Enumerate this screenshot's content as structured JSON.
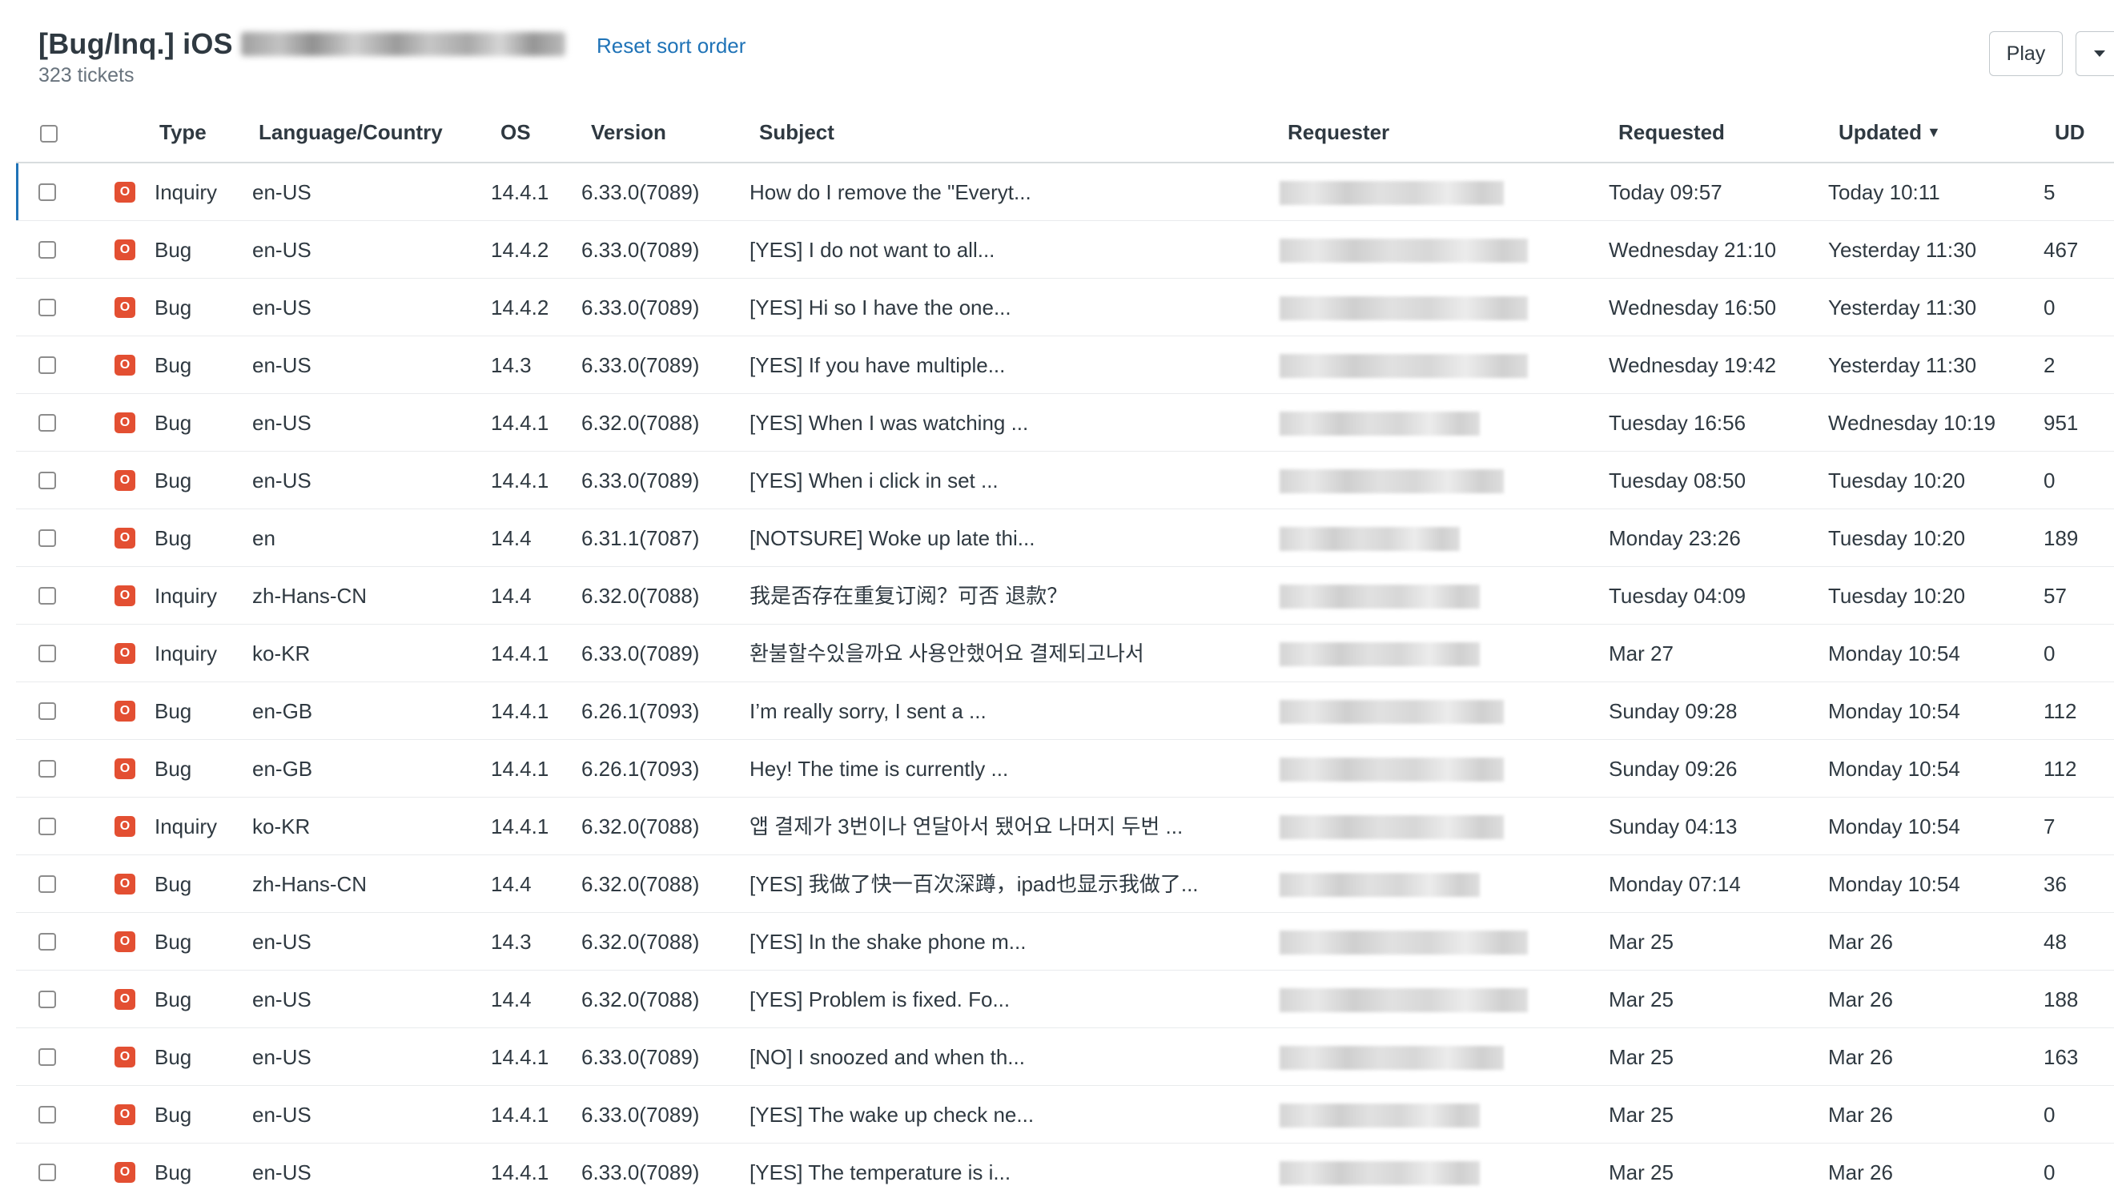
{
  "header": {
    "title": "[Bug/Inq.] iOS",
    "reset_link": "Reset sort order",
    "count": "323 tickets",
    "play_label": "Play"
  },
  "columns": {
    "type": "Type",
    "language": "Language/Country",
    "os": "OS",
    "version": "Version",
    "subject": "Subject",
    "requester": "Requester",
    "requested": "Requested",
    "updated": "Updated",
    "updated_sort": "▼",
    "ud": "UD"
  },
  "status_icon_letter": "O",
  "colors": {
    "accent": "#1f73b7",
    "open_status": "#e34f32"
  },
  "rows": [
    {
      "type": "Inquiry",
      "lang": "en-US",
      "os": "14.4.1",
      "version": "6.33.0(7089)",
      "subject": "How do I remove the \"Everyt...",
      "requested": "Today 09:57",
      "updated": "Today 10:11",
      "ud": "5"
    },
    {
      "type": "Bug",
      "lang": "en-US",
      "os": "14.4.2",
      "version": "6.33.0(7089)",
      "subject": "[YES] I do not want to all...",
      "requested": "Wednesday 21:10",
      "updated": "Yesterday 11:30",
      "ud": "467"
    },
    {
      "type": "Bug",
      "lang": "en-US",
      "os": "14.4.2",
      "version": "6.33.0(7089)",
      "subject": "[YES] Hi so I have the one...",
      "requested": "Wednesday 16:50",
      "updated": "Yesterday 11:30",
      "ud": "0"
    },
    {
      "type": "Bug",
      "lang": "en-US",
      "os": "14.3",
      "version": "6.33.0(7089)",
      "subject": "[YES] If you have multiple...",
      "requested": "Wednesday 19:42",
      "updated": "Yesterday 11:30",
      "ud": "2"
    },
    {
      "type": "Bug",
      "lang": "en-US",
      "os": "14.4.1",
      "version": "6.32.0(7088)",
      "subject": "[YES] When I was watching ...",
      "requested": "Tuesday 16:56",
      "updated": "Wednesday 10:19",
      "ud": "951"
    },
    {
      "type": "Bug",
      "lang": "en-US",
      "os": "14.4.1",
      "version": "6.33.0(7089)",
      "subject": "[YES] When i click in set ...",
      "requested": "Tuesday 08:50",
      "updated": "Tuesday 10:20",
      "ud": "0"
    },
    {
      "type": "Bug",
      "lang": "en",
      "os": "14.4",
      "version": "6.31.1(7087)",
      "subject": "[NOTSURE] Woke up late thi...",
      "requested": "Monday 23:26",
      "updated": "Tuesday 10:20",
      "ud": "189"
    },
    {
      "type": "Inquiry",
      "lang": "zh-Hans-CN",
      "os": "14.4",
      "version": "6.32.0(7088)",
      "subject": "我是否存在重复订阅？可否 退款？",
      "requested": "Tuesday 04:09",
      "updated": "Tuesday 10:20",
      "ud": "57"
    },
    {
      "type": "Inquiry",
      "lang": "ko-KR",
      "os": "14.4.1",
      "version": "6.33.0(7089)",
      "subject": "환불할수있을까요 사용안했어요 결제되고나서",
      "requested": "Mar 27",
      "updated": "Monday 10:54",
      "ud": "0"
    },
    {
      "type": "Bug",
      "lang": "en-GB",
      "os": "14.4.1",
      "version": "6.26.1(7093)",
      "subject": "I’m really sorry, I sent a ...",
      "requested": "Sunday 09:28",
      "updated": "Monday 10:54",
      "ud": "112"
    },
    {
      "type": "Bug",
      "lang": "en-GB",
      "os": "14.4.1",
      "version": "6.26.1(7093)",
      "subject": "Hey! The time is currently ...",
      "requested": "Sunday 09:26",
      "updated": "Monday 10:54",
      "ud": "112"
    },
    {
      "type": "Inquiry",
      "lang": "ko-KR",
      "os": "14.4.1",
      "version": "6.32.0(7088)",
      "subject": "앱 결제가 3번이나 연달아서 됐어요 나머지 두번 ...",
      "requested": "Sunday 04:13",
      "updated": "Monday 10:54",
      "ud": "7"
    },
    {
      "type": "Bug",
      "lang": "zh-Hans-CN",
      "os": "14.4",
      "version": "6.32.0(7088)",
      "subject": "[YES] 我做了快一百次深蹲，ipad也显示我做了...",
      "requested": "Monday 07:14",
      "updated": "Monday 10:54",
      "ud": "36"
    },
    {
      "type": "Bug",
      "lang": "en-US",
      "os": "14.3",
      "version": "6.32.0(7088)",
      "subject": "[YES] In the shake phone m...",
      "requested": "Mar 25",
      "updated": "Mar 26",
      "ud": "48"
    },
    {
      "type": "Bug",
      "lang": "en-US",
      "os": "14.4",
      "version": "6.32.0(7088)",
      "subject": "[YES] Problem is fixed. Fo...",
      "requested": "Mar 25",
      "updated": "Mar 26",
      "ud": "188"
    },
    {
      "type": "Bug",
      "lang": "en-US",
      "os": "14.4.1",
      "version": "6.33.0(7089)",
      "subject": "[NO] I snoozed and when th...",
      "requested": "Mar 25",
      "updated": "Mar 26",
      "ud": "163"
    },
    {
      "type": "Bug",
      "lang": "en-US",
      "os": "14.4.1",
      "version": "6.33.0(7089)",
      "subject": "[YES] The wake up check ne...",
      "requested": "Mar 25",
      "updated": "Mar 26",
      "ud": "0"
    },
    {
      "type": "Bug",
      "lang": "en-US",
      "os": "14.4.1",
      "version": "6.33.0(7089)",
      "subject": "[YES] The temperature is i...",
      "requested": "Mar 25",
      "updated": "Mar 26",
      "ud": "0"
    }
  ]
}
